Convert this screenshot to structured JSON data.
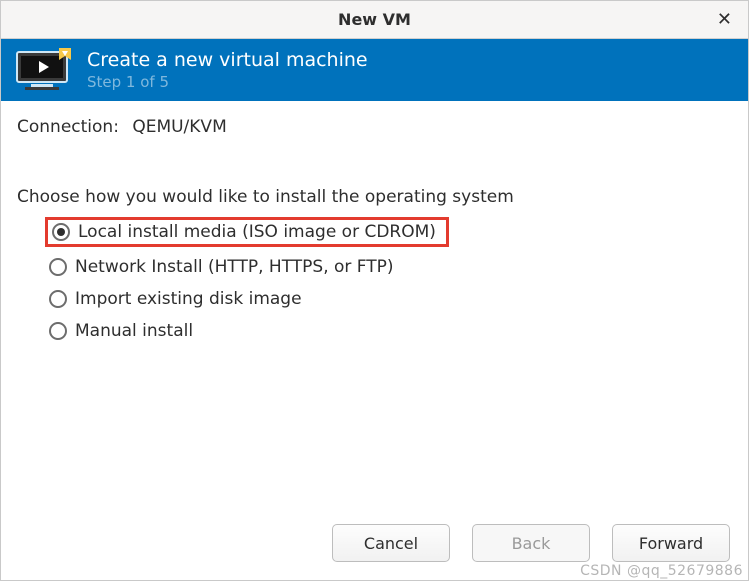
{
  "titlebar": {
    "title": "New VM"
  },
  "banner": {
    "heading": "Create a new virtual machine",
    "step": "Step 1 of 5"
  },
  "connection": {
    "label": "Connection:",
    "value": "QEMU/KVM"
  },
  "prompt": "Choose how you would like to install the operating system",
  "options": [
    {
      "label": "Local install media (ISO image or CDROM)",
      "selected": true,
      "highlighted": true
    },
    {
      "label": "Network Install (HTTP, HTTPS, or FTP)",
      "selected": false,
      "highlighted": false
    },
    {
      "label": "Import existing disk image",
      "selected": false,
      "highlighted": false
    },
    {
      "label": "Manual install",
      "selected": false,
      "highlighted": false
    }
  ],
  "buttons": {
    "cancel": "Cancel",
    "back": "Back",
    "forward": "Forward"
  },
  "watermark": "CSDN @qq_52679886"
}
